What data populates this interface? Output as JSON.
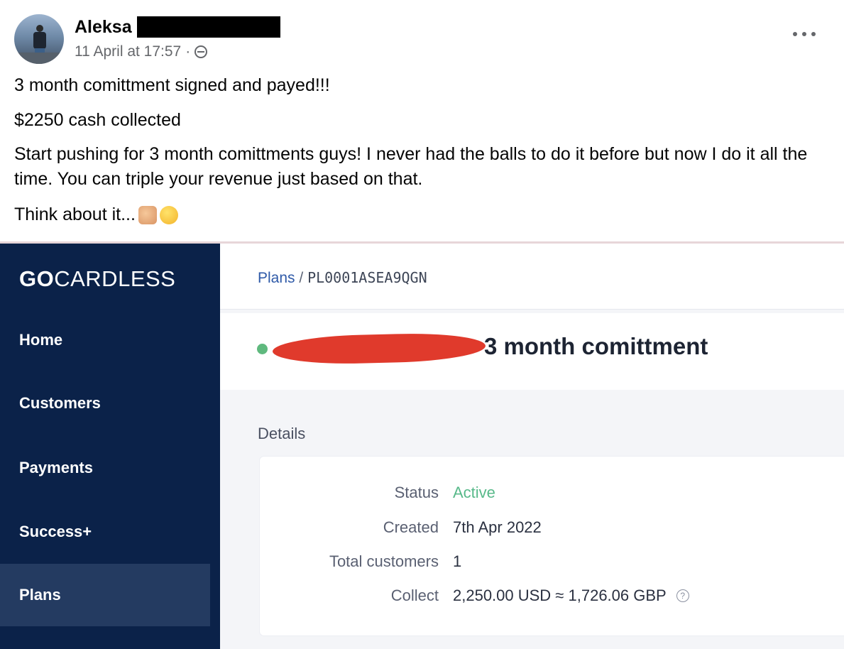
{
  "post": {
    "author": "Aleksa",
    "timestamp": "11 April at 17:57",
    "separator": "·",
    "privacy_icon": "globe-icon",
    "lines": [
      "3 month comittment signed and payed!!!",
      "$2250 cash collected",
      "Start pushing for 3 month comittments guys! I never had the balls to do it before but now I do it all the time. You can triple your revenue just based on that.",
      "Think about it..."
    ]
  },
  "gocardless": {
    "logo_bold": "GO",
    "logo_rest": "CARDLESS",
    "nav": [
      "Home",
      "Customers",
      "Payments",
      "Success+",
      "Plans"
    ],
    "active_nav": "Plans",
    "breadcrumb": {
      "link": "Plans",
      "sep": "/",
      "plan_id": "PL0001ASEA9QGN"
    },
    "plan_title": "3 month comittment",
    "details_label": "Details",
    "details": {
      "status_label": "Status",
      "status_value": "Active",
      "created_label": "Created",
      "created_value": "7th Apr 2022",
      "total_label": "Total customers",
      "total_value": "1",
      "collect_label": "Collect",
      "collect_value": "2,250.00 USD ≈ 1,726.06 GBP"
    }
  },
  "colors": {
    "sidebar": "#0b2249",
    "sidebar_active": "#243b61",
    "status_active": "#58b98a",
    "redaction_red": "#e03a2c"
  }
}
